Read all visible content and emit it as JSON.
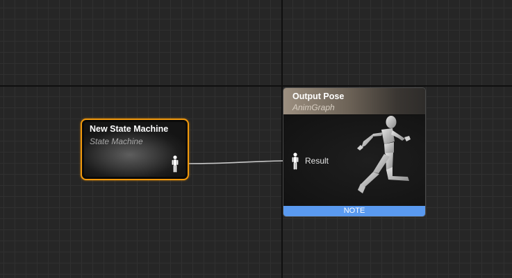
{
  "state_machine_node": {
    "title": "New State Machine",
    "subtitle": "State Machine",
    "pin_icon": "pose-icon",
    "border_color": "#f39a0c"
  },
  "output_pose_node": {
    "title": "Output Pose",
    "subtitle": "AnimGraph",
    "pin_label": "Result",
    "pin_icon": "pose-icon",
    "preview_icon": "running-mannequin-icon",
    "note_label": "NOTE",
    "note_color": "#5a9af0"
  },
  "canvas": {
    "background_color": "#262626",
    "wire_color": "#c8c8c8"
  }
}
